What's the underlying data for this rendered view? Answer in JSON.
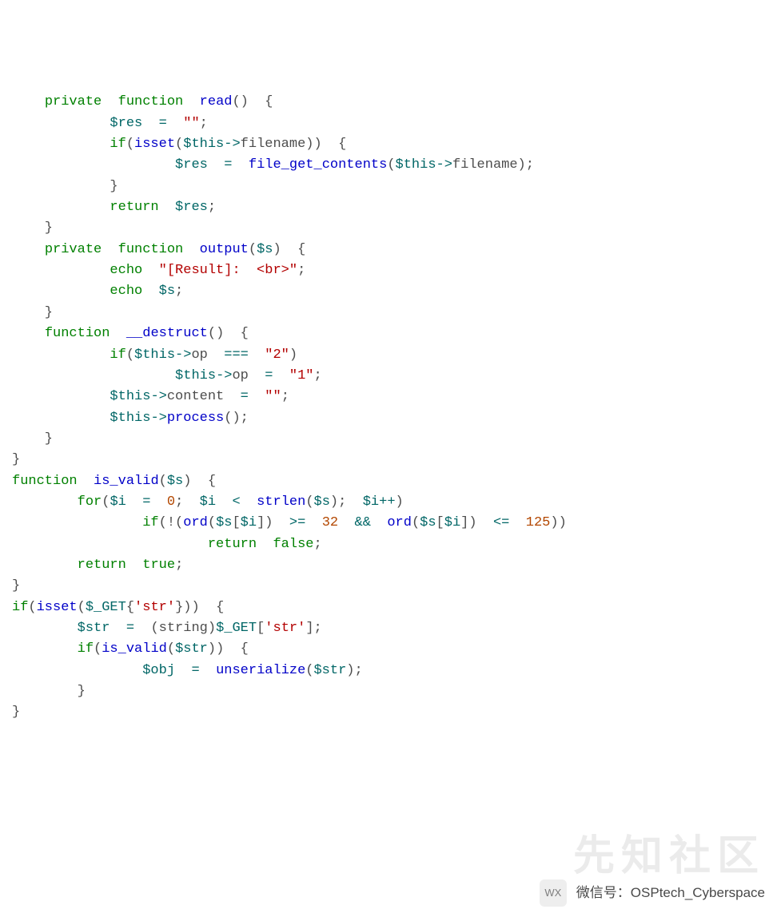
{
  "code": {
    "lines": [
      [
        [
          "plain",
          "    "
        ],
        [
          "kw",
          "private"
        ],
        [
          "plain",
          "  "
        ],
        [
          "kw",
          "function"
        ],
        [
          "plain",
          "  "
        ],
        [
          "fn",
          "read"
        ],
        [
          "plain",
          "()  {"
        ]
      ],
      [
        [
          "plain",
          "            "
        ],
        [
          "var",
          "$res"
        ],
        [
          "plain",
          "  "
        ],
        [
          "op",
          "="
        ],
        [
          "plain",
          "  "
        ],
        [
          "str",
          "\"\""
        ],
        [
          "plain",
          ";"
        ]
      ],
      [
        [
          "plain",
          "            "
        ],
        [
          "kw",
          "if"
        ],
        [
          "plain",
          "("
        ],
        [
          "fn",
          "isset"
        ],
        [
          "plain",
          "("
        ],
        [
          "var",
          "$this"
        ],
        [
          "op",
          "->"
        ],
        [
          "plain",
          "filename))  {"
        ]
      ],
      [
        [
          "plain",
          "                    "
        ],
        [
          "var",
          "$res"
        ],
        [
          "plain",
          "  "
        ],
        [
          "op",
          "="
        ],
        [
          "plain",
          "  "
        ],
        [
          "fn",
          "file_get_contents"
        ],
        [
          "plain",
          "("
        ],
        [
          "var",
          "$this"
        ],
        [
          "op",
          "->"
        ],
        [
          "plain",
          "filename);"
        ]
      ],
      [
        [
          "plain",
          "            }"
        ]
      ],
      [
        [
          "plain",
          "            "
        ],
        [
          "kw",
          "return"
        ],
        [
          "plain",
          "  "
        ],
        [
          "var",
          "$res"
        ],
        [
          "plain",
          ";"
        ]
      ],
      [
        [
          "plain",
          "    }"
        ]
      ],
      [
        [
          "plain",
          ""
        ]
      ],
      [
        [
          "plain",
          "    "
        ],
        [
          "kw",
          "private"
        ],
        [
          "plain",
          "  "
        ],
        [
          "kw",
          "function"
        ],
        [
          "plain",
          "  "
        ],
        [
          "fn",
          "output"
        ],
        [
          "plain",
          "("
        ],
        [
          "var",
          "$s"
        ],
        [
          "plain",
          ")  {"
        ]
      ],
      [
        [
          "plain",
          "            "
        ],
        [
          "kw",
          "echo"
        ],
        [
          "plain",
          "  "
        ],
        [
          "str",
          "\"[Result]:  <br>\""
        ],
        [
          "plain",
          ";"
        ]
      ],
      [
        [
          "plain",
          "            "
        ],
        [
          "kw",
          "echo"
        ],
        [
          "plain",
          "  "
        ],
        [
          "var",
          "$s"
        ],
        [
          "plain",
          ";"
        ]
      ],
      [
        [
          "plain",
          "    }"
        ]
      ],
      [
        [
          "plain",
          ""
        ]
      ],
      [
        [
          "plain",
          "    "
        ],
        [
          "kw",
          "function"
        ],
        [
          "plain",
          "  "
        ],
        [
          "fn",
          "__destruct"
        ],
        [
          "plain",
          "()  {"
        ]
      ],
      [
        [
          "plain",
          "            "
        ],
        [
          "kw",
          "if"
        ],
        [
          "plain",
          "("
        ],
        [
          "var",
          "$this"
        ],
        [
          "op",
          "->"
        ],
        [
          "plain",
          "op  "
        ],
        [
          "op",
          "==="
        ],
        [
          "plain",
          "  "
        ],
        [
          "str",
          "\"2\""
        ],
        [
          "plain",
          ")"
        ]
      ],
      [
        [
          "plain",
          "                    "
        ],
        [
          "var",
          "$this"
        ],
        [
          "op",
          "->"
        ],
        [
          "plain",
          "op  "
        ],
        [
          "op",
          "="
        ],
        [
          "plain",
          "  "
        ],
        [
          "str",
          "\"1\""
        ],
        [
          "plain",
          ";"
        ]
      ],
      [
        [
          "plain",
          "            "
        ],
        [
          "var",
          "$this"
        ],
        [
          "op",
          "->"
        ],
        [
          "plain",
          "content  "
        ],
        [
          "op",
          "="
        ],
        [
          "plain",
          "  "
        ],
        [
          "str",
          "\"\""
        ],
        [
          "plain",
          ";"
        ]
      ],
      [
        [
          "plain",
          "            "
        ],
        [
          "var",
          "$this"
        ],
        [
          "op",
          "->"
        ],
        [
          "fn",
          "process"
        ],
        [
          "plain",
          "();"
        ]
      ],
      [
        [
          "plain",
          "    }"
        ]
      ],
      [
        [
          "plain",
          ""
        ]
      ],
      [
        [
          "plain",
          "}"
        ]
      ],
      [
        [
          "plain",
          ""
        ]
      ],
      [
        [
          "kw",
          "function"
        ],
        [
          "plain",
          "  "
        ],
        [
          "fn",
          "is_valid"
        ],
        [
          "plain",
          "("
        ],
        [
          "var",
          "$s"
        ],
        [
          "plain",
          ")  {"
        ]
      ],
      [
        [
          "plain",
          "        "
        ],
        [
          "kw",
          "for"
        ],
        [
          "plain",
          "("
        ],
        [
          "var",
          "$i"
        ],
        [
          "plain",
          "  "
        ],
        [
          "op",
          "="
        ],
        [
          "plain",
          "  "
        ],
        [
          "num",
          "0"
        ],
        [
          "plain",
          ";  "
        ],
        [
          "var",
          "$i"
        ],
        [
          "plain",
          "  "
        ],
        [
          "op",
          "<"
        ],
        [
          "plain",
          "  "
        ],
        [
          "fn",
          "strlen"
        ],
        [
          "plain",
          "("
        ],
        [
          "var",
          "$s"
        ],
        [
          "plain",
          ");  "
        ],
        [
          "var",
          "$i"
        ],
        [
          "op",
          "++"
        ],
        [
          "plain",
          ")"
        ]
      ],
      [
        [
          "plain",
          "                "
        ],
        [
          "kw",
          "if"
        ],
        [
          "plain",
          "(!("
        ],
        [
          "fn",
          "ord"
        ],
        [
          "plain",
          "("
        ],
        [
          "var",
          "$s"
        ],
        [
          "plain",
          "["
        ],
        [
          "var",
          "$i"
        ],
        [
          "plain",
          "])  "
        ],
        [
          "op",
          ">="
        ],
        [
          "plain",
          "  "
        ],
        [
          "num",
          "32"
        ],
        [
          "plain",
          "  "
        ],
        [
          "op",
          "&&"
        ],
        [
          "plain",
          "  "
        ],
        [
          "fn",
          "ord"
        ],
        [
          "plain",
          "("
        ],
        [
          "var",
          "$s"
        ],
        [
          "plain",
          "["
        ],
        [
          "var",
          "$i"
        ],
        [
          "plain",
          "])  "
        ],
        [
          "op",
          "<="
        ],
        [
          "plain",
          "  "
        ],
        [
          "num",
          "125"
        ],
        [
          "plain",
          "))"
        ]
      ],
      [
        [
          "plain",
          "                        "
        ],
        [
          "kw",
          "return"
        ],
        [
          "plain",
          "  "
        ],
        [
          "kw",
          "false"
        ],
        [
          "plain",
          ";"
        ]
      ],
      [
        [
          "plain",
          "        "
        ],
        [
          "kw",
          "return"
        ],
        [
          "plain",
          "  "
        ],
        [
          "kw",
          "true"
        ],
        [
          "plain",
          ";"
        ]
      ],
      [
        [
          "plain",
          "}"
        ]
      ],
      [
        [
          "plain",
          ""
        ]
      ],
      [
        [
          "kw",
          "if"
        ],
        [
          "plain",
          "("
        ],
        [
          "fn",
          "isset"
        ],
        [
          "plain",
          "("
        ],
        [
          "var",
          "$_GET"
        ],
        [
          "plain",
          "{"
        ],
        [
          "str",
          "'str'"
        ],
        [
          "plain",
          "}))  {"
        ]
      ],
      [
        [
          "plain",
          ""
        ]
      ],
      [
        [
          "plain",
          "        "
        ],
        [
          "var",
          "$str"
        ],
        [
          "plain",
          "  "
        ],
        [
          "op",
          "="
        ],
        [
          "plain",
          "  (string)"
        ],
        [
          "var",
          "$_GET"
        ],
        [
          "plain",
          "["
        ],
        [
          "str",
          "'str'"
        ],
        [
          "plain",
          "];"
        ]
      ],
      [
        [
          "plain",
          "        "
        ],
        [
          "kw",
          "if"
        ],
        [
          "plain",
          "("
        ],
        [
          "fn",
          "is_valid"
        ],
        [
          "plain",
          "("
        ],
        [
          "var",
          "$str"
        ],
        [
          "plain",
          "))  {"
        ]
      ],
      [
        [
          "plain",
          "                "
        ],
        [
          "var",
          "$obj"
        ],
        [
          "plain",
          "  "
        ],
        [
          "op",
          "="
        ],
        [
          "plain",
          "  "
        ],
        [
          "fn",
          "unserialize"
        ],
        [
          "plain",
          "("
        ],
        [
          "var",
          "$str"
        ],
        [
          "plain",
          ");"
        ]
      ],
      [
        [
          "plain",
          "        }"
        ]
      ],
      [
        [
          "plain",
          ""
        ]
      ],
      [
        [
          "plain",
          "}"
        ]
      ]
    ]
  },
  "watermark": {
    "bg_text": "先知社区",
    "label": "微信号：",
    "account": "OSPtech_Cyberspace",
    "icon_abbr": "WX"
  }
}
